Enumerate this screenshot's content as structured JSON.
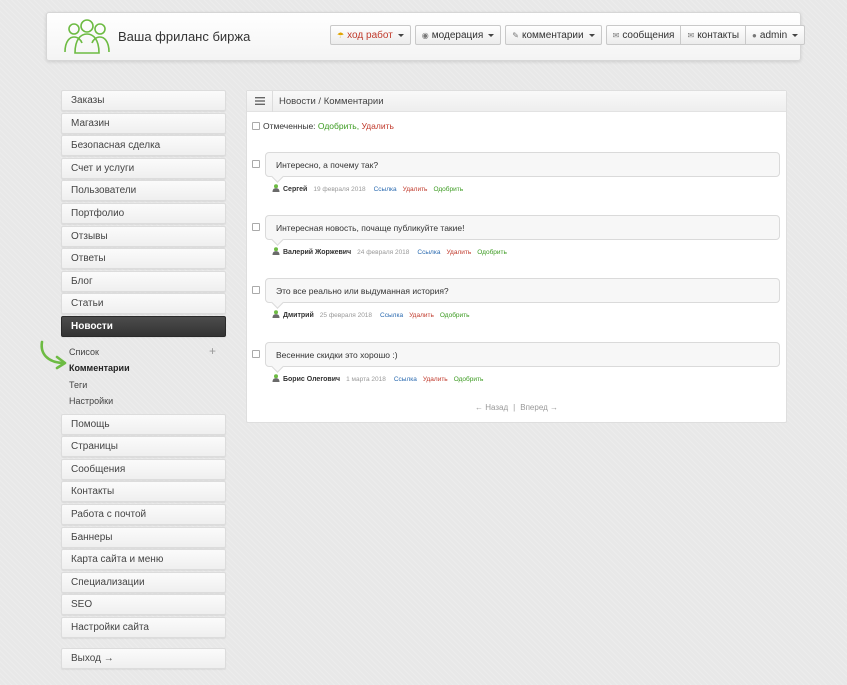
{
  "header": {
    "site_title": "Ваша фриланс биржа",
    "nav": {
      "work": "ход работ",
      "moderation": "модерация",
      "comments": "комментарии",
      "messages": "сообщения",
      "contacts": "контакты",
      "user": "admin"
    }
  },
  "sidebar": {
    "items_top": [
      "Заказы",
      "Магазин",
      "Безопасная сделка",
      "Счет и услуги",
      "Пользователи",
      "Портфолио",
      "Отзывы",
      "Ответы",
      "Блог",
      "Статьи"
    ],
    "active": "Новости",
    "submenu": [
      "Список",
      "Комментарии",
      "Теги",
      "Настройки"
    ],
    "submenu_current": "Комментарии",
    "items_bottom": [
      "Помощь",
      "Страницы",
      "Сообщения",
      "Контакты",
      "Работа с почтой",
      "Баннеры",
      "Карта сайта и меню",
      "Специализации",
      "SEO",
      "Настройки сайта"
    ],
    "exit": "Выход →"
  },
  "main": {
    "breadcrumb": "Новости / Комментарии",
    "bulk": {
      "label": "Отмеченные:",
      "approve": "Одобрить,",
      "delete": "Удалить"
    },
    "comments": [
      {
        "text": "Интересно, а почему так?",
        "author": "Сергей",
        "date": "19 февраля 2018",
        "link": "Ссылка",
        "delete": "Удалить",
        "approve": "Одобрить"
      },
      {
        "text": "Интересная новость, почаще публикуйте такие!",
        "author": "Валерий Жоржевич",
        "date": "24 февраля 2018",
        "link": "Ссылка",
        "delete": "Удалить",
        "approve": "Одобрить"
      },
      {
        "text": "Это все реально или выдуманная история?",
        "author": "Дмитрий",
        "date": "25 февраля 2018",
        "link": "Ссылка",
        "delete": "Удалить",
        "approve": "Одобрить"
      },
      {
        "text": "Весенние скидки это хорошо :)",
        "author": "Борис Олегович",
        "date": "1 марта 2018",
        "link": "Ссылка",
        "delete": "Удалить",
        "approve": "Одобрить"
      }
    ],
    "pager": {
      "prev": "← Назад",
      "sep": "|",
      "next": "Вперед →"
    }
  },
  "colors": {
    "accent_green": "#6dbb43",
    "active_menu": "#3a3a3a",
    "delete_red": "#c0392b",
    "link_blue": "#2a6ab0"
  }
}
